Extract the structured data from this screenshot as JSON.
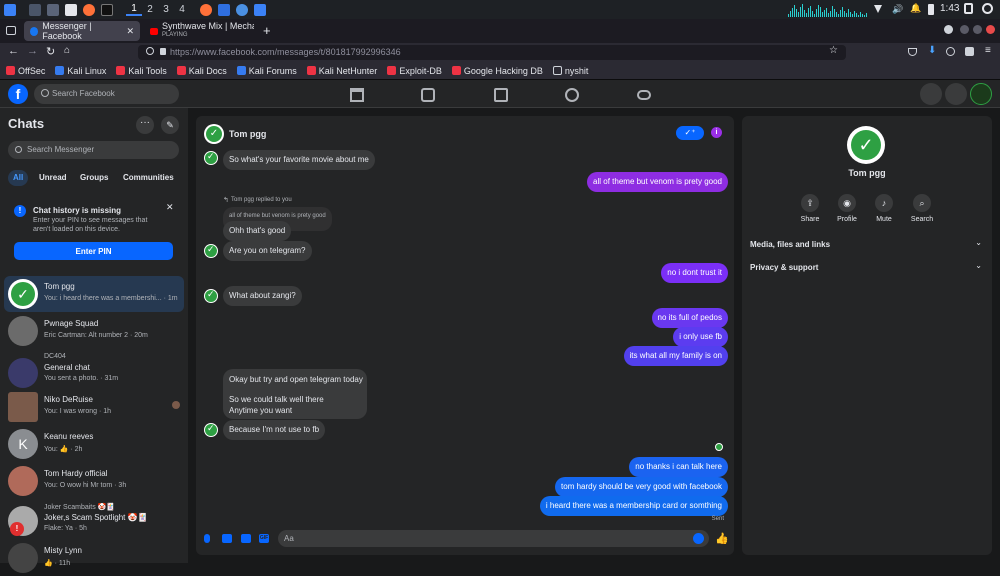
{
  "os": {
    "workspaces": [
      "1",
      "2",
      "3",
      "4"
    ],
    "clock": "1:43"
  },
  "browser": {
    "tab_active": "Messenger | Facebook",
    "tab_music_title": "Synthwave Mix | Mecha C",
    "tab_music_status": "PLAYING",
    "url": "https://www.facebook.com/messages/t/801817992996346",
    "bookmarks": [
      "OffSec",
      "Kali Linux",
      "Kali Tools",
      "Kali Docs",
      "Kali Forums",
      "Kali NetHunter",
      "Exploit-DB",
      "Google Hacking DB",
      "nyshit"
    ]
  },
  "fb": {
    "search_placeholder": "Search Facebook"
  },
  "left": {
    "title": "Chats",
    "search_placeholder": "Search Messenger",
    "filters": [
      "All",
      "Unread",
      "Groups",
      "Communities"
    ],
    "notice_title": "Chat history is missing",
    "notice_body_1": "Enter your PIN to see messages that",
    "notice_body_2": "aren't loaded on this device.",
    "pin_button": "Enter PIN",
    "chats": [
      {
        "name": "Tom pgg",
        "preview": "You: i heard there was a membershi... · 1m",
        "color": "#ffffff"
      },
      {
        "name": "Pwnage Squad",
        "preview": "Eric Cartman: Alt number 2 · 20m",
        "color": "#6b6b6b"
      },
      {
        "group": "DC404",
        "name": "General chat",
        "preview": "You sent a photo. · 31m",
        "color": "#3a3a6a"
      },
      {
        "name": "Niko DeRuise",
        "preview": "You: I was wrong · 1h",
        "color": "#7a5a4a"
      },
      {
        "name": "Keanu reeves",
        "preview": "You: 👍 · 2h",
        "color": "#8a8d91"
      },
      {
        "name": "Tom Hardy official",
        "preview": "You: O wow hi Mr tom · 3h",
        "color": "#b06a5a"
      },
      {
        "name": "Joker Scambaits 🤡🃏",
        "name2": "Joker,s Scam Spotlight 🤡🃏",
        "preview": "Flake: Ya · 5h",
        "color": "#aaaaaa"
      },
      {
        "name": "Misty Lynn",
        "preview": "👍 · 11h",
        "color": "#444444"
      }
    ]
  },
  "conv": {
    "name": "Tom pgg",
    "reply_label": "Tom pgg replied to you",
    "quoted": "all of theme but venom is prety good",
    "messages": [
      {
        "dir": "in",
        "text": "So what's your favorite movie about me"
      },
      {
        "dir": "out",
        "text": "all of theme but venom is prety good",
        "color": "#8e2de2"
      },
      {
        "dir": "in",
        "text": "Ohh that's good"
      },
      {
        "dir": "in",
        "text": "Are you on telegram?"
      },
      {
        "dir": "out",
        "text": "no i dont trust it",
        "color": "#7b2ff7"
      },
      {
        "dir": "in",
        "text": "What about zangi?"
      },
      {
        "dir": "out",
        "text": "no its full of pedos",
        "color": "#6a38f0"
      },
      {
        "dir": "out",
        "text": "i only use fb",
        "color": "#5c3cf0"
      },
      {
        "dir": "out",
        "text": "its what all my family is on",
        "color": "#5240ee"
      },
      {
        "dir": "in",
        "text": "Okay but try and open telegram today"
      },
      {
        "dir": "in",
        "text": "So we could talk well there"
      },
      {
        "dir": "in",
        "text": "Anytime you want"
      },
      {
        "dir": "in",
        "text": "Because I'm not use to fb"
      },
      {
        "dir": "out",
        "text": "no thanks i can talk here",
        "color": "#1b63f0"
      },
      {
        "dir": "out",
        "text": "tom hardy should be very good with facebook",
        "color": "#1567ef"
      },
      {
        "dir": "out",
        "text": "i heard there was a membership card or somthing",
        "color": "#106bee"
      }
    ],
    "status": "Sent",
    "composer_placeholder": "Aa"
  },
  "right": {
    "name": "Tom pgg",
    "actions": [
      "Share",
      "Profile",
      "Mute",
      "Search"
    ],
    "sections": [
      "Media, files and links",
      "Privacy & support"
    ]
  },
  "colors": {
    "accent": "#0866ff",
    "bg": "#18191a",
    "panel": "#242526",
    "green": "#2ea043"
  }
}
